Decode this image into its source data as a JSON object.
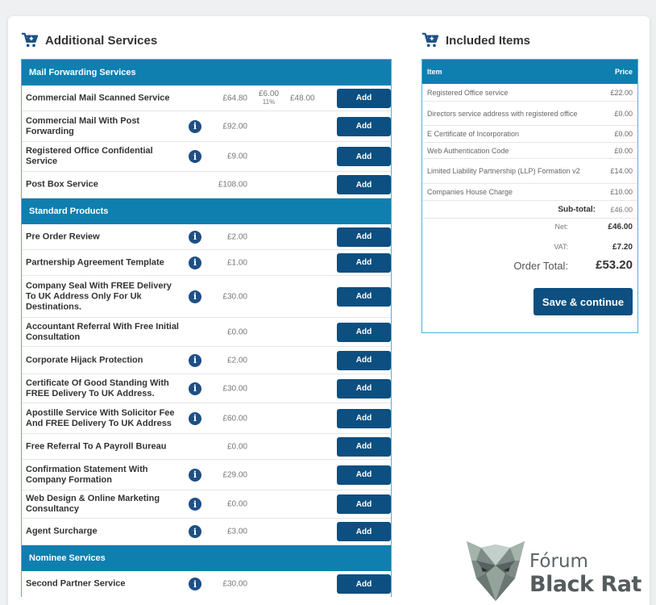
{
  "additional_services": {
    "title": "Additional Services",
    "add_label": "Add",
    "sections": [
      {
        "title": "Mail Forwarding Services",
        "rows": [
          {
            "name": "Commercial Mail Scanned Service",
            "info": false,
            "price": "£64.80",
            "discount": "£6.00",
            "discount_pct": "11%",
            "new_price": "£48.00",
            "h": 32
          },
          {
            "name": "Commercial Mail With Post Forwarding",
            "info": true,
            "price": "£92.00",
            "h": 38
          },
          {
            "name": "Registered Office Confidential Service",
            "info": true,
            "price": "£9.00",
            "h": 37
          },
          {
            "name": "Post Box Service",
            "info": false,
            "price": "£108.00",
            "h": 33
          }
        ]
      },
      {
        "title": "Standard Products",
        "rows": [
          {
            "name": "Pre Order Review",
            "info": true,
            "price": "£2.00",
            "h": 32
          },
          {
            "name": "Partnership Agreement Template",
            "info": true,
            "price": "£1.00",
            "h": 32
          },
          {
            "name": "Company Seal With FREE Delivery To UK Address Only For Uk Destinations.",
            "info": true,
            "price": "£30.00",
            "h": 52
          },
          {
            "name": "Accountant Referral With Free Initial Consultation",
            "info": false,
            "price": "£0.00",
            "h": 36
          },
          {
            "name": "Corporate Hijack Protection",
            "info": true,
            "price": "£2.00",
            "h": 34
          },
          {
            "name": "Certificate Of Good Standing With FREE Delivery To UK Address.",
            "info": true,
            "price": "£30.00",
            "h": 36
          },
          {
            "name": "Apostille Service With Solicitor Fee And FREE Delivery To UK Address",
            "info": true,
            "price": "£60.00",
            "h": 38
          },
          {
            "name": "Free Referral To A Payroll Bureau",
            "info": false,
            "price": "£0.00",
            "h": 32
          },
          {
            "name": "Confirmation Statement With Company Formation",
            "info": true,
            "price": "£29.00",
            "h": 38
          },
          {
            "name": "Web Design & Online Marketing Consultancy",
            "info": true,
            "price": "£0.00",
            "h": 35
          },
          {
            "name": "Agent Surcharge",
            "info": true,
            "price": "£3.00",
            "h": 33
          }
        ]
      },
      {
        "title": "Nominee Services",
        "rows": [
          {
            "name": "Second Partner Service",
            "info": true,
            "price": "£30.00",
            "h": 32
          }
        ]
      }
    ]
  },
  "included_items": {
    "title": "Included Items",
    "col_item": "Item",
    "col_price": "Price",
    "rows": [
      {
        "name": "Registered Office service",
        "price": "£22.00",
        "h": 22
      },
      {
        "name": "Directors service address with registered office",
        "price": "£0.00",
        "h": 30
      },
      {
        "name": "E Certificate of Incorporation",
        "price": "£0.00",
        "h": 21
      },
      {
        "name": "Web Authentication Code",
        "price": "£0.00",
        "h": 20
      },
      {
        "name": "Limited Liability Partnership (LLP) Formation v2",
        "price": "£14.00",
        "h": 31
      },
      {
        "name": "Companies House Charge",
        "price": "£10.00",
        "h": 21
      }
    ],
    "subtotal_label": "Sub-total:",
    "subtotal_value": "£46.00",
    "net_label": "Net:",
    "net_value": "£46.00",
    "vat_label": "VAT:",
    "vat_value": "£7.20",
    "order_total_label": "Order Total:",
    "order_total_value": "£53.20",
    "save_label": "Save & continue"
  },
  "watermark": {
    "line1": "Fórum",
    "line2": "Black Rat"
  }
}
